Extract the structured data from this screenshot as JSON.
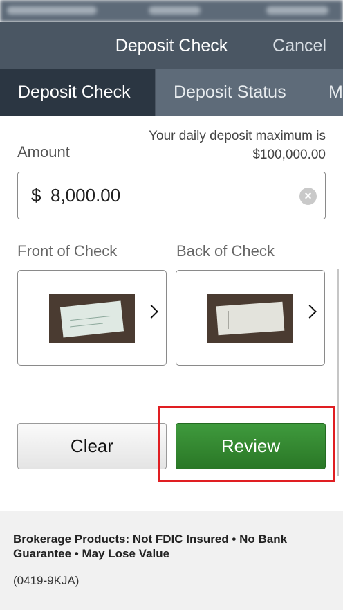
{
  "nav": {
    "title": "Deposit Check",
    "cancel": "Cancel"
  },
  "tabs": [
    {
      "label": "Deposit Check",
      "active": true
    },
    {
      "label": "Deposit Status",
      "active": false
    },
    {
      "label": "M",
      "active": false
    }
  ],
  "limit_note": {
    "line1": "Your daily deposit maximum is",
    "line2": "$100,000.00"
  },
  "amount": {
    "label": "Amount",
    "currency": "$",
    "value": "8,000.00"
  },
  "check": {
    "front_label": "Front of Check",
    "back_label": "Back of Check"
  },
  "buttons": {
    "clear": "Clear",
    "review": "Review"
  },
  "footer": {
    "disclaimer": "Brokerage Products: Not FDIC Insured • No Bank Guarantee • May Lose Value",
    "code": "(0419-9KJA)"
  },
  "colors": {
    "nav_bg": "#4a5663",
    "tab_active": "#2b3642",
    "review_green": "#2e7d2a",
    "highlight_red": "#e01e22"
  }
}
